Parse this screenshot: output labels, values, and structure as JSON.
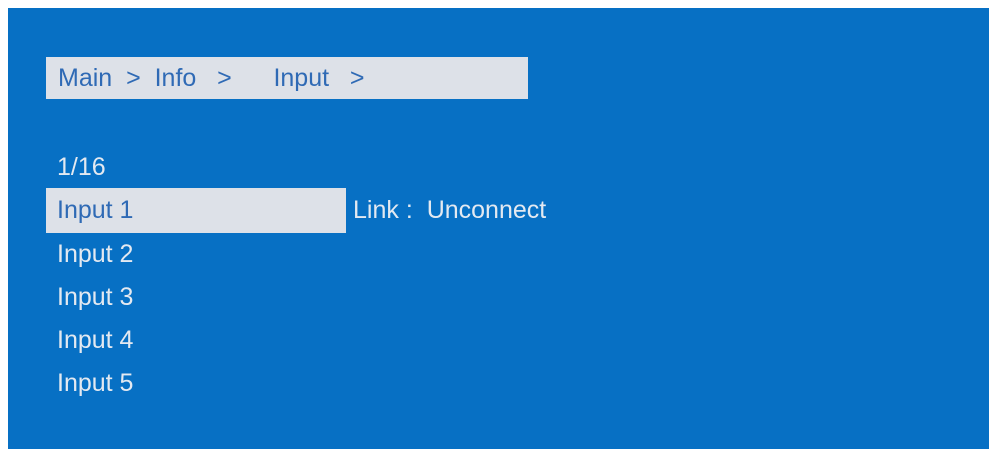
{
  "breadcrumb": {
    "items": [
      "Main",
      "Info",
      "Input"
    ],
    "separator": ">"
  },
  "counter": "1/16",
  "inputs": [
    {
      "label": "Input 1",
      "selected": true
    },
    {
      "label": "Input 2",
      "selected": false
    },
    {
      "label": "Input 3",
      "selected": false
    },
    {
      "label": "Input 4",
      "selected": false
    },
    {
      "label": "Input 5",
      "selected": false
    }
  ],
  "detail": {
    "key": "Link",
    "separator": ":",
    "value": "Unconnect"
  },
  "colors": {
    "background": "#0770c4",
    "highlight": "#dde1e8",
    "highlight_text": "#2f6ab5",
    "text": "#e3e9f1"
  }
}
